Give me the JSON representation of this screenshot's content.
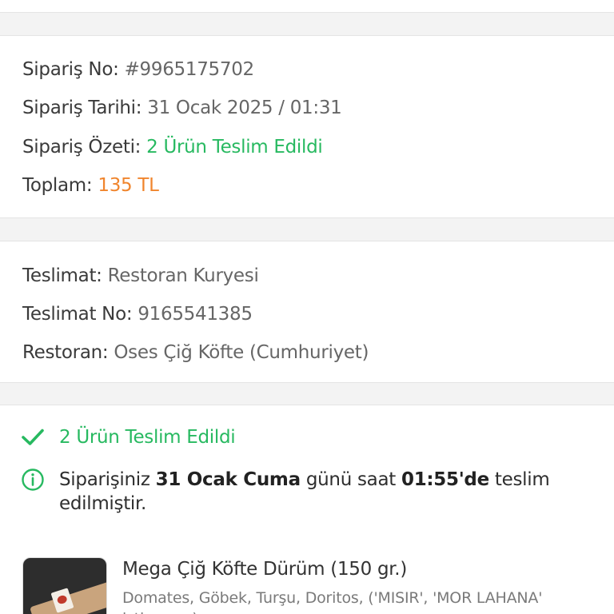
{
  "order": {
    "no_label": "Sipariş No:",
    "no_value": "#9965175702",
    "date_label": "Sipariş Tarihi:",
    "date_value": "31 Ocak 2025 / 01:31",
    "summary_label": "Sipariş Özeti:",
    "summary_value": "2 Ürün Teslim Edildi",
    "total_label": "Toplam:",
    "total_value": "135 TL"
  },
  "delivery": {
    "type_label": "Teslimat:",
    "type_value": "Restoran Kuryesi",
    "no_label": "Teslimat No:",
    "no_value": "9165541385",
    "restaurant_label": "Restoran:",
    "restaurant_value": "Oses Çiğ Köfte (Cumhuriyet)"
  },
  "status": {
    "text": "2 Ürün Teslim Edildi",
    "info_prefix": "Siparişiniz ",
    "info_date": "31 Ocak Cuma",
    "info_middle": " günü saat ",
    "info_time": "01:55'de",
    "info_suffix": " teslim edilmiştir."
  },
  "product": {
    "name": "Mega Çiğ Köfte Dürüm (150 gr.)",
    "description": "Domates, Göbek, Turşu, Doritos, ('MISIR', 'MOR LAHANA' istiyorum)"
  },
  "icons": {
    "status": "check-icon",
    "info": "info-circle-icon"
  },
  "colors": {
    "green": "#27b960",
    "orange": "#f0852d"
  }
}
